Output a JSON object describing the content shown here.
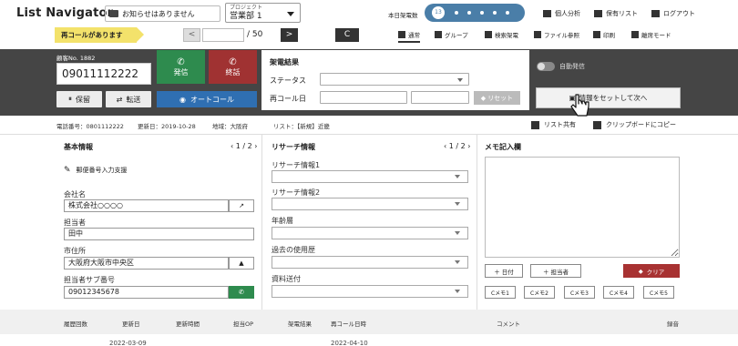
{
  "app": {
    "title": "List Navigator."
  },
  "header": {
    "notice": "お知らせはありません",
    "project_label": "プロジェクト",
    "project_value": "営業部 1",
    "callcount_label": "本日架電数",
    "callcount_value": "13",
    "nav": [
      "個人分析",
      "保有リスト",
      "ログアウト"
    ]
  },
  "toolbar": {
    "recall_banner": "再コールがあります",
    "page_prev": "<",
    "page_total": "/ 50",
    "page_next": ">",
    "refresh": "C",
    "modes": [
      "通常",
      "グループ",
      "検索架電",
      "ファイル参照",
      "印刷",
      "離席モード"
    ]
  },
  "call": {
    "customer_no": "顧客No. 1882",
    "phone": "09011112222",
    "call_label": "発信",
    "end_label": "終話",
    "hold_label": "保留",
    "transfer_label": "転送",
    "auto_label": "オートコール"
  },
  "result": {
    "title": "架電結果",
    "status_label": "ステータス",
    "recall_label": "再コール日",
    "reset_label": "リセット",
    "auto_dial_label": "自動発信",
    "next_label": "情報をセットして次へ"
  },
  "inforow": {
    "tel": "電話番号：0801112222",
    "updated": "更新日：2019-10-28",
    "area": "地域：大阪府",
    "list": "リスト：【新規】近畿",
    "share": "リスト共有",
    "clipboard": "クリップボードにコピー"
  },
  "basic": {
    "title": "基本情報",
    "pager": "1 / 2",
    "postal_helper": "郵便番号入力支援",
    "fields": [
      {
        "label": "会社名",
        "value": "株式会社○○○○"
      },
      {
        "label": "担当者",
        "value": "田中"
      },
      {
        "label": "市住所",
        "value": "大阪府大阪市中央区"
      },
      {
        "label": "担当者サブ番号",
        "value": "09012345678"
      }
    ]
  },
  "research": {
    "title": "リサーチ情報",
    "pager": "1 / 2",
    "fields": [
      "リサーチ情報1",
      "リサーチ情報2",
      "年齢層",
      "過去の使用歴",
      "資料送付"
    ]
  },
  "memo": {
    "title": "メモ記入欄",
    "date_btn": "＋ 日付",
    "person_btn": "＋ 担当者",
    "clear_btn": "クリア",
    "custom_btns": [
      "Cメモ1",
      "Cメモ2",
      "Cメモ3",
      "Cメモ4",
      "Cメモ5"
    ]
  },
  "history": {
    "headers": [
      "履歴回数",
      "更新日",
      "更新時間",
      "担当OP",
      "架電結果",
      "再コール日時",
      "コメント",
      "録音"
    ],
    "row_date": "2022-03-09",
    "row_recall": "2022-04-10"
  }
}
